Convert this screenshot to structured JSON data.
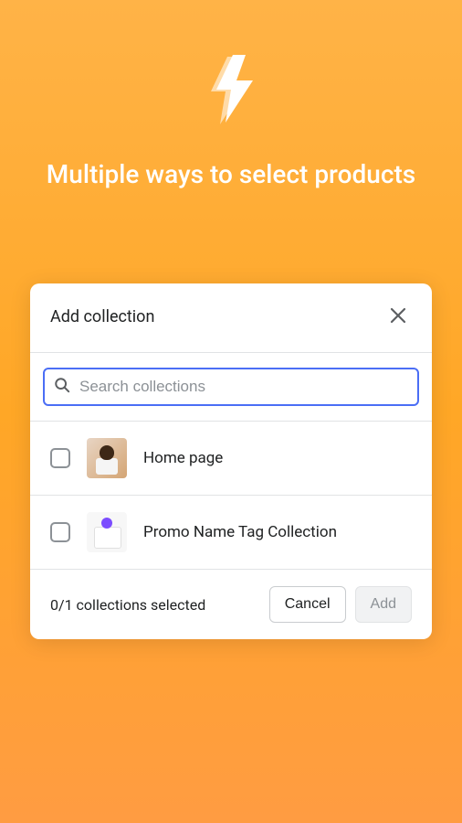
{
  "hero": {
    "title": "Multiple ways to select products"
  },
  "modal": {
    "title": "Add collection",
    "search": {
      "placeholder": "Search collections",
      "value": ""
    },
    "collections": [
      {
        "label": "Home page",
        "checked": false
      },
      {
        "label": "Promo Name Tag Collection",
        "checked": false
      }
    ],
    "footer": {
      "status": "0/1 collections selected",
      "cancel_label": "Cancel",
      "add_label": "Add"
    }
  }
}
